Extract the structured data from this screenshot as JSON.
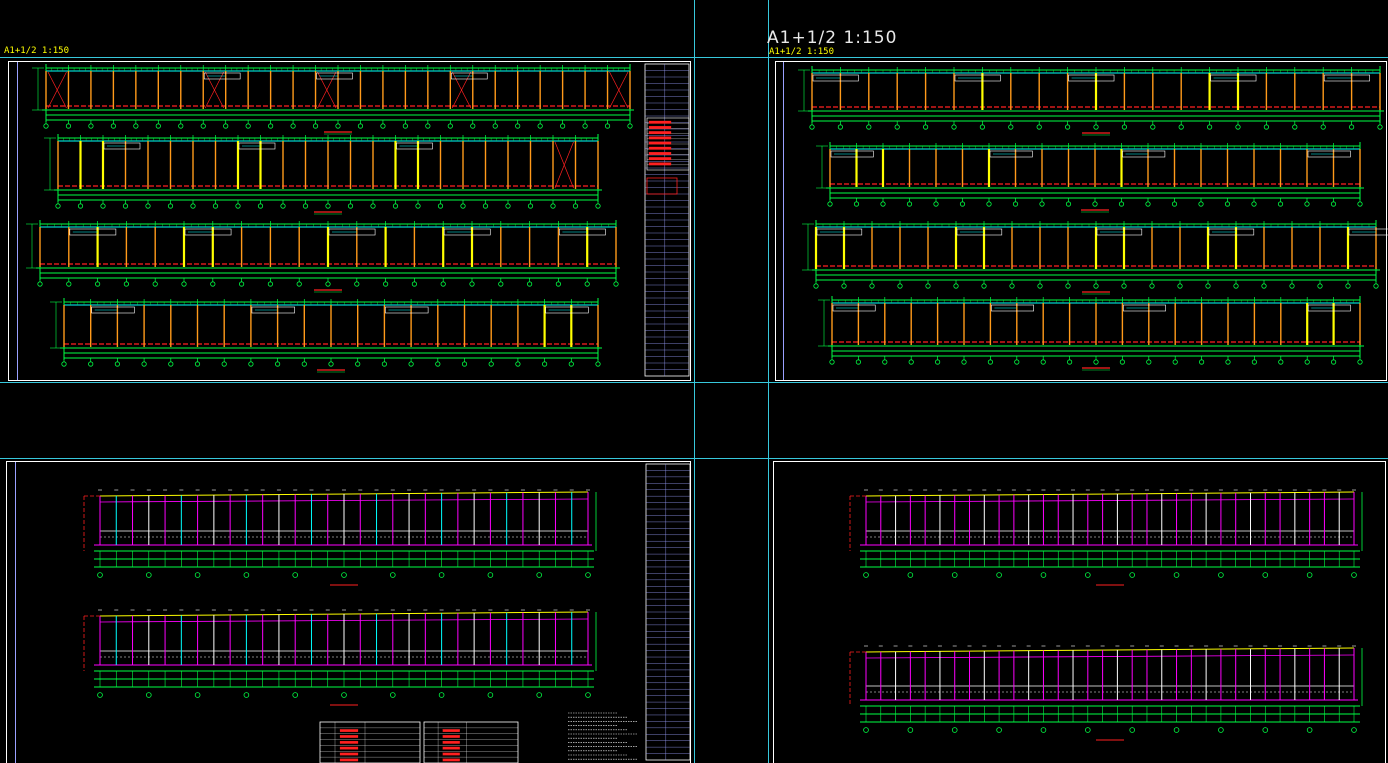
{
  "viewport": {
    "background": "#000000",
    "crosshair_color": "#37c8dc"
  },
  "sheets": {
    "top_left": {
      "label": "A1+1/2 1:150"
    },
    "top_right": {
      "label_large": "A1+1/2  1:150",
      "label_small": "A1+1/2 1:150"
    }
  },
  "colors": {
    "border": "#ffffff",
    "grid_green": "#00ff44",
    "column_orange": "#ff9a1a",
    "column_yellow": "#ffff00",
    "red_dash": "#ff2020",
    "cyan": "#00ffff",
    "magenta": "#ff00ff",
    "title_block": "#9aa0ff"
  }
}
